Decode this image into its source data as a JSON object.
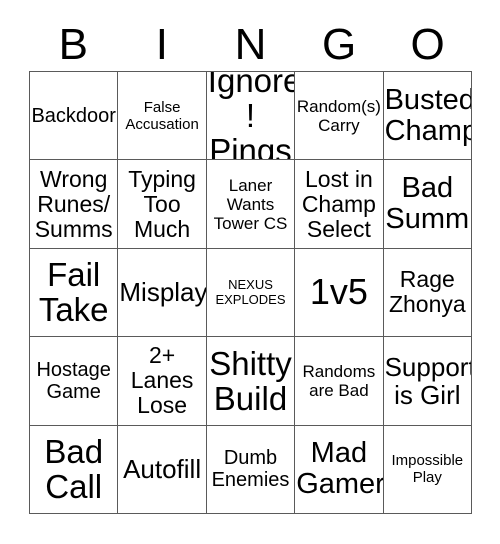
{
  "card": {
    "title": "BINGO",
    "header_letters": [
      "B",
      "I",
      "N",
      "G",
      "O"
    ],
    "grid": {
      "rows": 5,
      "columns": 5,
      "border_color": "#5a5a5a",
      "background_color": "#ffffff",
      "text_color": "#000000"
    },
    "cells": [
      {
        "text": "Backdoor",
        "size": "sz-m"
      },
      {
        "text": "False\nAccusation",
        "size": "sz-xs"
      },
      {
        "text": "Ignore\n! Pings",
        "size": "sz-xxl"
      },
      {
        "text": "Random(s)\nCarry",
        "size": "sz-s"
      },
      {
        "text": "Busted\nChamp",
        "size": "sz-xl"
      },
      {
        "text": "Wrong\nRunes/\nSumms",
        "size": "sz-ml"
      },
      {
        "text": "Typing\nToo\nMuch",
        "size": "sz-ml"
      },
      {
        "text": "Laner\nWants\nTower CS",
        "size": "sz-s"
      },
      {
        "text": "Lost in\nChamp\nSelect",
        "size": "sz-ml"
      },
      {
        "text": "Bad\nSumm",
        "size": "sz-xl"
      },
      {
        "text": "Fail\nTake",
        "size": "sz-xxl"
      },
      {
        "text": "Misplay",
        "size": "sz-l"
      },
      {
        "text": "NEXUS\nEXPLODES",
        "size": "sz-xxs"
      },
      {
        "text": "1v5",
        "size": "sz-huge"
      },
      {
        "text": "Rage\nZhonya",
        "size": "sz-ml"
      },
      {
        "text": "Hostage\nGame",
        "size": "sz-m"
      },
      {
        "text": "2+\nLanes\nLose",
        "size": "sz-ml"
      },
      {
        "text": "Shitty\nBuild",
        "size": "sz-xxl"
      },
      {
        "text": "Randoms\nare Bad",
        "size": "sz-s"
      },
      {
        "text": "Support\nis Girl",
        "size": "sz-l"
      },
      {
        "text": "Bad\nCall",
        "size": "sz-xxl"
      },
      {
        "text": "Autofill",
        "size": "sz-l"
      },
      {
        "text": "Dumb\nEnemies",
        "size": "sz-m"
      },
      {
        "text": "Mad\nGamer",
        "size": "sz-xl"
      },
      {
        "text": "Impossible\nPlay",
        "size": "sz-xs"
      }
    ]
  }
}
